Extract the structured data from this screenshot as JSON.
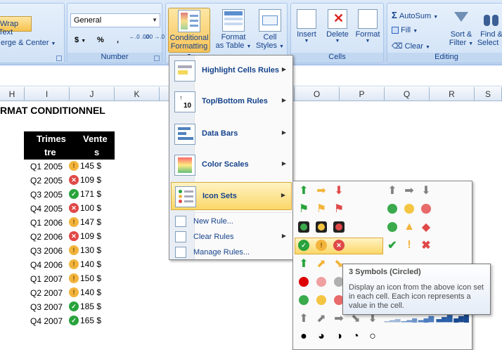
{
  "ribbon": {
    "alignment": {
      "wrap_text": "Wrap Text",
      "merge_center": "erge & Center"
    },
    "number": {
      "format_value": "General",
      "currency": "$",
      "percent": "%",
      "comma": ",",
      "inc_decimal": "←.0 .00",
      "dec_decimal": ".00 →.0",
      "label": "Number"
    },
    "styles": {
      "conditional_formatting": "Conditional Formatting",
      "cf_line1": "Conditional",
      "cf_line2": "Formatting",
      "format_as_table_line1": "Format",
      "format_as_table_line2": "as Table",
      "cell_styles_line1": "Cell",
      "cell_styles_line2": "Styles"
    },
    "cells": {
      "insert": "Insert",
      "delete": "Delete",
      "format": "Format",
      "label": "Cells"
    },
    "editing": {
      "autosum": "AutoSum",
      "fill": "Fill",
      "clear": "Clear",
      "sort_line1": "Sort &",
      "sort_line2": "Filter",
      "find_line1": "Find &",
      "find_line2": "Select",
      "label": "Editing"
    }
  },
  "columns": [
    "H",
    "I",
    "J",
    "K",
    "O",
    "P",
    "Q",
    "R",
    "S"
  ],
  "sheet": {
    "title": "RMAT CONDITIONNEL",
    "header": {
      "col1_line1": "Trimes",
      "col1_line2": "tre",
      "col2_line1": "Vente",
      "col2_line2": "s"
    },
    "rows": [
      {
        "quarter": "Q1 2005",
        "icon": "yellow",
        "value": "145 $"
      },
      {
        "quarter": "Q2 2005",
        "icon": "red",
        "value": "109 $"
      },
      {
        "quarter": "Q3 2005",
        "icon": "green",
        "value": "171 $"
      },
      {
        "quarter": "Q4 2005",
        "icon": "red",
        "value": "100 $"
      },
      {
        "quarter": "Q1 2006",
        "icon": "yellow",
        "value": "147 $"
      },
      {
        "quarter": "Q2 2006",
        "icon": "red",
        "value": "109 $"
      },
      {
        "quarter": "Q3 2006",
        "icon": "yellow",
        "value": "130 $"
      },
      {
        "quarter": "Q4 2006",
        "icon": "yellow",
        "value": "140 $"
      },
      {
        "quarter": "Q1 2007",
        "icon": "yellow",
        "value": "150 $"
      },
      {
        "quarter": "Q2 2007",
        "icon": "yellow",
        "value": "140 $"
      },
      {
        "quarter": "Q3 2007",
        "icon": "green",
        "value": "185 $"
      },
      {
        "quarter": "Q4 2007",
        "icon": "green",
        "value": "165 $"
      }
    ]
  },
  "menu": {
    "items": [
      {
        "label": "Highlight Cells Rules"
      },
      {
        "label": "Top/Bottom Rules"
      },
      {
        "label": "Data Bars"
      },
      {
        "label": "Color Scales"
      },
      {
        "label": "Icon Sets"
      }
    ],
    "small_items": [
      {
        "label": "New Rule..."
      },
      {
        "label": "Clear Rules"
      },
      {
        "label": "Manage Rules..."
      }
    ]
  },
  "tooltip": {
    "title": "3 Symbols (Circled)",
    "body": "Display an icon from the above icon set in each cell. Each icon represents a value in the cell."
  },
  "colors": {
    "accent": "#15428b",
    "highlight": "#fbd768",
    "green": "#29a33c",
    "yellow": "#f2b43c",
    "red": "#e04848"
  }
}
